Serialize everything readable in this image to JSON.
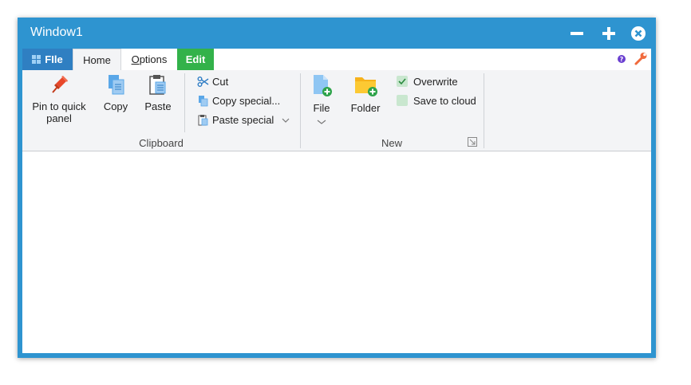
{
  "window": {
    "title": "Window1"
  },
  "tabs": {
    "file": "FIle",
    "home": "Home",
    "options_first": "O",
    "options_rest": "ptions",
    "edit": "Edit"
  },
  "clipboard": {
    "pin_line1": "Pin to quick",
    "pin_line2": "panel",
    "copy": "Copy",
    "paste": "Paste",
    "cut": "Cut",
    "copy_special": "Copy special...",
    "paste_special": "Paste special",
    "group_label": "Clipboard"
  },
  "new_group": {
    "file": "File",
    "folder": "Folder",
    "overwrite": "Overwrite",
    "overwrite_checked": true,
    "save_to_cloud": "Save to cloud",
    "save_to_cloud_checked": false,
    "group_label": "New"
  },
  "colors": {
    "titlebar": "#2e94d0",
    "file_tab": "#2f7fc2",
    "edit_tab": "#33b24a",
    "ribbon_bg": "#f3f4f6"
  }
}
